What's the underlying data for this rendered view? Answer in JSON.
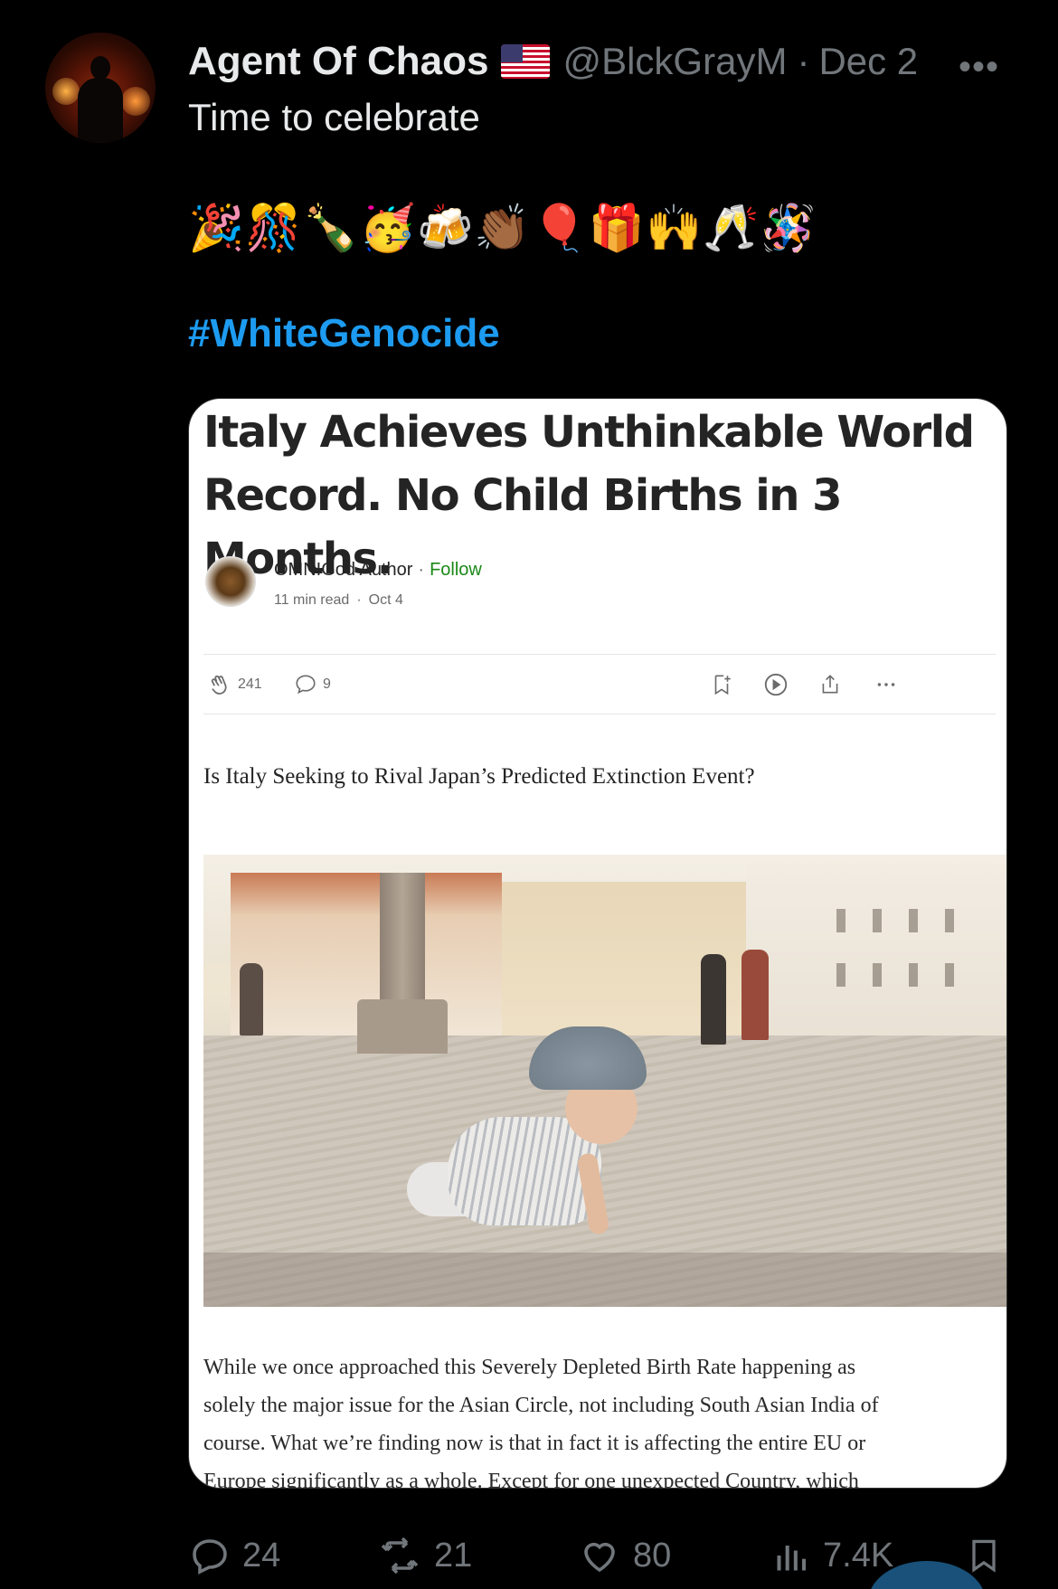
{
  "tweet": {
    "author_name": "Agent Of Chaos",
    "flag_icon": "us-flag-icon",
    "handle": "@BlckGrayM",
    "separator": "·",
    "date": "Dec 2",
    "more_label": "•••",
    "text": "Time to celebrate",
    "emojis": "🎉🎊🍾🥳🍻👏🏾🎈🎁🙌🥂🪅",
    "hashtag": "#WhiteGenocide"
  },
  "article": {
    "headline": "Italy Achieves Unthinkable World Record. No Child Births in 3 Months.",
    "author": "OMNIGod Author",
    "separator": "·",
    "follow": "Follow",
    "read_time": "11 min read",
    "date": "Oct 4",
    "claps": "241",
    "responses": "9",
    "subtitle": "Is Italy Seeking to Rival Japan’s Predicted Extinction Event?",
    "body_lines": [
      "While we once approached this Severely Depleted Birth Rate happening as",
      "solely the major issue for the Asian Circle, not including South Asian India of",
      "course. What we’re finding now is that in fact it is affecting the entire EU or",
      "Europe significantly as a whole. Except for one unexpected Country, which"
    ]
  },
  "footer": {
    "replies": "24",
    "reposts": "21",
    "likes": "80",
    "views": "7.4K"
  },
  "colors": {
    "background": "#000000",
    "hashtag": "#1d9bf0",
    "follow": "#1a8917",
    "muted": "#71767b"
  }
}
